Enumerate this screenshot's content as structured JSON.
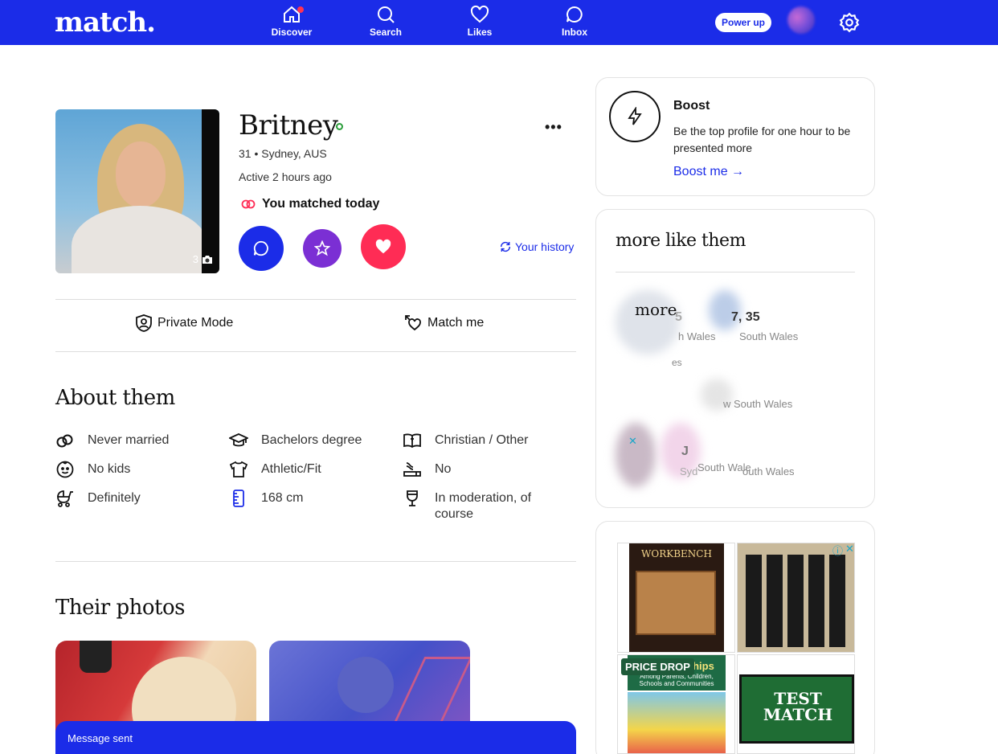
{
  "nav": {
    "logo": "match.",
    "items": [
      {
        "label": "Discover"
      },
      {
        "label": "Search"
      },
      {
        "label": "Likes"
      },
      {
        "label": "Inbox"
      }
    ],
    "power_up": "Power up"
  },
  "profile": {
    "name": "Britney",
    "age_location": "31 • Sydney, AUS",
    "active": "Active 2 hours ago",
    "matched": "You matched today",
    "photo_count": "3",
    "history": "Your history",
    "private_mode": "Private Mode",
    "match_me": "Match me"
  },
  "about": {
    "title": "About them",
    "attributes": [
      {
        "icon": "rings-icon",
        "text": "Never married"
      },
      {
        "icon": "graduation-cap-icon",
        "text": "Bachelors degree"
      },
      {
        "icon": "book-icon",
        "text": "Christian / Other"
      },
      {
        "icon": "baby-face-icon",
        "text": "No kids"
      },
      {
        "icon": "tshirt-icon",
        "text": "Athletic/Fit"
      },
      {
        "icon": "cigarette-icon",
        "text": "No"
      },
      {
        "icon": "stroller-icon",
        "text": "Definitely"
      },
      {
        "icon": "ruler-icon",
        "text": "168 cm"
      },
      {
        "icon": "wine-glass-icon",
        "text": "In moderation, of course"
      }
    ]
  },
  "photos": {
    "title": "Their photos"
  },
  "toast": "Message sent",
  "boost": {
    "title": "Boost",
    "description": "Be the top profile for one hour to be presented more",
    "link": "Boost me →"
  },
  "more_like_them": {
    "title": "more like them",
    "overlay": "more",
    "fragments": {
      "f1": "5",
      "f2": "h Wales",
      "f3": "7, 35",
      "f4": "South Wales",
      "f5": "es",
      "f6": "w South Wales",
      "f7": "J",
      "f8": "Syd",
      "f9": "South Wale",
      "f10": "outh Wales"
    }
  },
  "ads": {
    "workbench": "WORKBENCH",
    "price_drop": "PRICE DROP",
    "relationships": "onships",
    "relationships_sub": "Among Parents, Children, Schools and Communities",
    "test_match": "TEST MATCH"
  },
  "colors": {
    "brand": "#1b2ce8",
    "like": "#ff2c55",
    "superlike": "#7b2fd4"
  }
}
